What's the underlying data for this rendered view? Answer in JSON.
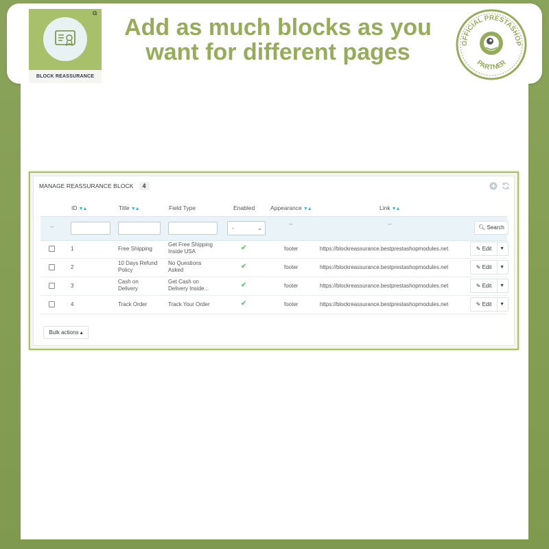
{
  "banner": {
    "headline_line1": "Add as much blocks as you",
    "headline_line2": "want for different pages",
    "logo_label": "BLOCK REASSURANCE",
    "badge_text": "OFFICIAL PRESTASHOP PARTNER"
  },
  "card": {
    "title": "MANAGE REASSURANCE BLOCK",
    "count": "4"
  },
  "table": {
    "headers": {
      "id": "ID",
      "title": "Title",
      "field_type": "Field Type",
      "enabled": "Enabled",
      "appearance": "Appearance",
      "link": "Link"
    },
    "filter": {
      "dash": "--",
      "enabled_select_value": "-",
      "search_label": "Search"
    },
    "rows": [
      {
        "id": "1",
        "title_l1": "Free Shipping",
        "title_l2": "",
        "field_l1": "Get Free Shipping",
        "field_l2": "Inside USA",
        "enabled": "✔",
        "appearance": "footer",
        "link": "https://blockreassurance.bestprestashopmodules.net",
        "edit": "Edit"
      },
      {
        "id": "2",
        "title_l1": "10 Days Refund",
        "title_l2": "Policy",
        "field_l1": "No Questions",
        "field_l2": "Asked",
        "enabled": "✔",
        "appearance": "footer",
        "link": "https://blockreassurance.bestprestashopmodules.net",
        "edit": "Edit"
      },
      {
        "id": "3",
        "title_l1": "Cash on",
        "title_l2": "Delivery",
        "field_l1": "Get Cash on",
        "field_l2": "Delivery Inside...",
        "enabled": "✔",
        "appearance": "footer",
        "link": "https://blockreassurance.bestprestashopmodules.net",
        "edit": "Edit"
      },
      {
        "id": "4",
        "title_l1": "Track Order",
        "title_l2": "",
        "field_l1": "Track Your Order",
        "field_l2": "",
        "enabled": "✔",
        "appearance": "footer",
        "link": "https://blockreassurance.bestprestashopmodules.net",
        "edit": "Edit"
      }
    ],
    "bulk_actions": "Bulk actions ▴"
  },
  "icons": {
    "add": "plus-circle-icon",
    "refresh": "refresh-icon",
    "search": "search-icon",
    "edit": "pencil-icon",
    "caret": "caret-down-icon"
  },
  "colors": {
    "brand_green": "#95ad5b",
    "accent_blue": "#25b9d7",
    "check_green": "#72c279"
  }
}
